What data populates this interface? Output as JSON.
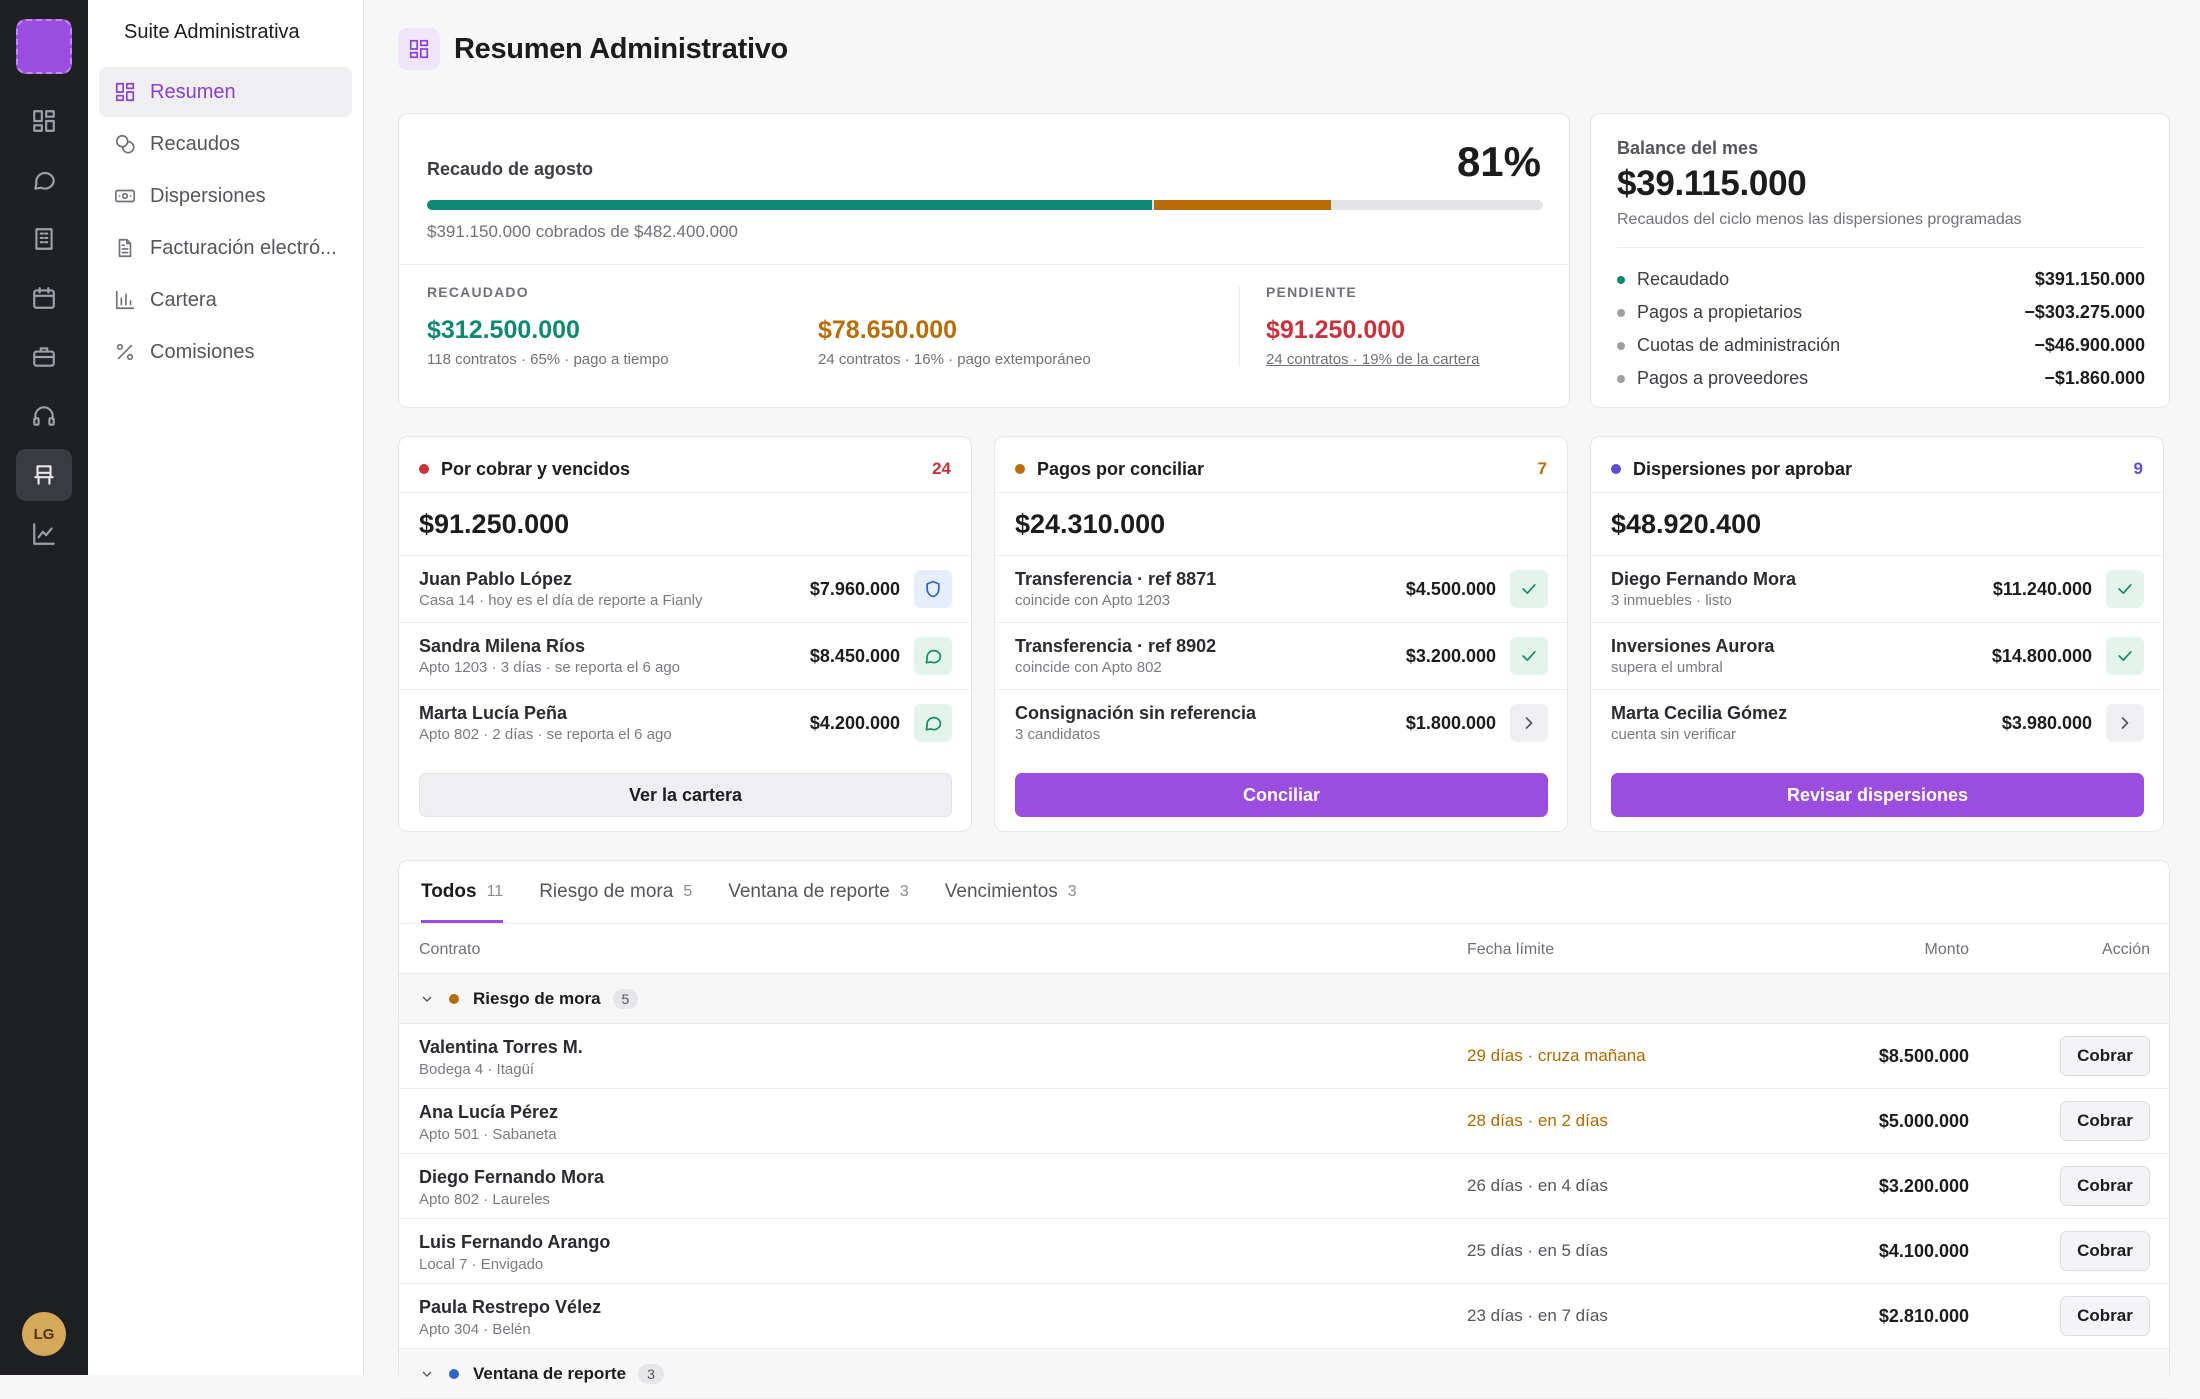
{
  "app": {
    "brand": "Suite Administrativa",
    "avatar_initials": "LG"
  },
  "sidebar": {
    "items": [
      {
        "label": "Resumen",
        "icon": "dashboard-icon",
        "active": true
      },
      {
        "label": "Recaudos",
        "icon": "coins-icon"
      },
      {
        "label": "Dispersiones",
        "icon": "banknote-icon"
      },
      {
        "label": "Facturación electró...",
        "icon": "file-text-icon"
      },
      {
        "label": "Cartera",
        "icon": "bar-chart-icon"
      },
      {
        "label": "Comisiones",
        "icon": "percent-icon"
      }
    ]
  },
  "page": {
    "title": "Resumen Administrativo"
  },
  "collection": {
    "label": "Recaudo de agosto",
    "percent": "81%",
    "progress_fraction": 0.81,
    "on_time_fraction": 0.65,
    "late_fraction": 0.16,
    "subtitle": "$391.150.000 cobrados de $482.400.000",
    "stats": [
      {
        "header": "RECAUDADO",
        "value": "$312.500.000",
        "detail": "118 contratos · 65% · pago a tiempo",
        "color": "#0f8a72"
      },
      {
        "header": "",
        "value": "$78.650.000",
        "detail": "24 contratos · 16% · pago extemporáneo",
        "color": "#b86d08"
      },
      {
        "header": "PENDIENTE",
        "value": "$91.250.000",
        "detail": "24 contratos · 19% de la cartera",
        "color": "#c8323b"
      }
    ]
  },
  "balance": {
    "header": "Balance del mes",
    "value": "$39.115.000",
    "subtitle": "Recaudos del ciclo menos las dispersiones programadas",
    "rows": [
      {
        "label": "Recaudado",
        "amount": "$391.150.000"
      },
      {
        "label": "Pagos a propietarios",
        "amount": "−$303.275.000"
      },
      {
        "label": "Cuotas de administración",
        "amount": "−$46.900.000"
      },
      {
        "label": "Pagos a proveedores",
        "amount": "−$1.860.000"
      }
    ]
  },
  "queues": [
    {
      "title": "Por cobrar y vencidos",
      "count": "24",
      "color": "#c8323b",
      "amount": "$91.250.000",
      "button": "Ver la cartera",
      "items": [
        {
          "name": "Juan Pablo López",
          "detail": "Casa 14 · hoy es el día de reporte a Fianly",
          "amount": "$7.960.000",
          "icon": "shield-icon"
        },
        {
          "name": "Sandra Milena Ríos",
          "detail": "Apto 1203 · 3 días · se reporta el 6 ago",
          "amount": "$8.450.000",
          "icon": "message-icon"
        },
        {
          "name": "Marta Lucía Peña",
          "detail": "Apto 802 · 2 días · se reporta el 6 ago",
          "amount": "$4.200.000",
          "icon": "message-icon"
        }
      ]
    },
    {
      "title": "Pagos por conciliar",
      "count": "7",
      "color": "#b86d08",
      "amount": "$24.310.000",
      "button": "Conciliar",
      "items": [
        {
          "name": "Transferencia · ref 8871",
          "detail": "coincide con Apto 1203",
          "amount": "$4.500.000",
          "icon": "check-icon"
        },
        {
          "name": "Transferencia · ref 8902",
          "detail": "coincide con Apto 802",
          "amount": "$3.200.000",
          "icon": "check-icon"
        },
        {
          "name": "Consignación sin referencia",
          "detail": "3 candidatos",
          "amount": "$1.800.000",
          "icon": "chevron-right-icon"
        }
      ]
    },
    {
      "title": "Dispersiones por aprobar",
      "count": "9",
      "color": "#5a4fd0",
      "amount": "$48.920.400",
      "button": "Revisar dispersiones",
      "items": [
        {
          "name": "Diego Fernando Mora",
          "detail": "3 inmuebles · listo",
          "amount": "$11.240.000",
          "icon": "check-icon"
        },
        {
          "name": "Inversiones Aurora",
          "detail": "supera el umbral",
          "amount": "$14.800.000",
          "icon": "check-icon"
        },
        {
          "name": "Marta Cecilia Gómez",
          "detail": "cuenta sin verificar",
          "amount": "$3.980.000",
          "icon": "chevron-right-icon"
        }
      ]
    }
  ],
  "table": {
    "tabs": [
      {
        "label": "Todos",
        "count": "11",
        "active": true
      },
      {
        "label": "Riesgo de mora",
        "count": "5"
      },
      {
        "label": "Ventana de reporte",
        "count": "3"
      },
      {
        "label": "Vencimientos",
        "count": "3"
      }
    ],
    "columns": {
      "contract": "Contrato",
      "deadline": "Fecha límite",
      "amount": "Monto",
      "action": "Acción"
    },
    "groups": [
      {
        "label": "Riesgo de mora",
        "count": "5",
        "color": "#b86d08"
      },
      {
        "label": "Ventana de reporte",
        "count": "3",
        "color": "#2d64c8"
      }
    ],
    "rows": [
      {
        "name": "Valentina Torres M.",
        "detail": "Bodega 4 · Itagüí",
        "deadline": "29 días · cruza mañana",
        "amount": "$8.500.000",
        "action": "Cobrar",
        "warn": true
      },
      {
        "name": "Ana Lucía Pérez",
        "detail": "Apto 501 · Sabaneta",
        "deadline": "28 días · en 2 días",
        "amount": "$5.000.000",
        "action": "Cobrar",
        "warn": true
      },
      {
        "name": "Diego Fernando Mora",
        "detail": "Apto 802 · Laureles",
        "deadline": "26 días · en 4 días",
        "amount": "$3.200.000",
        "action": "Cobrar"
      },
      {
        "name": "Luis Fernando Arango",
        "detail": "Local 7 · Envigado",
        "deadline": "25 días · en 5 días",
        "amount": "$4.100.000",
        "action": "Cobrar"
      },
      {
        "name": "Paula Restrepo Vélez",
        "detail": "Apto 304 · Belén",
        "deadline": "23 días · en 7 días",
        "amount": "$2.810.000",
        "action": "Cobrar"
      }
    ]
  },
  "colors": {
    "accent": "#9b4ddf",
    "success": "#0f8a72",
    "warning": "#b86d08",
    "danger": "#c8323b",
    "info": "#5a4fd0"
  }
}
